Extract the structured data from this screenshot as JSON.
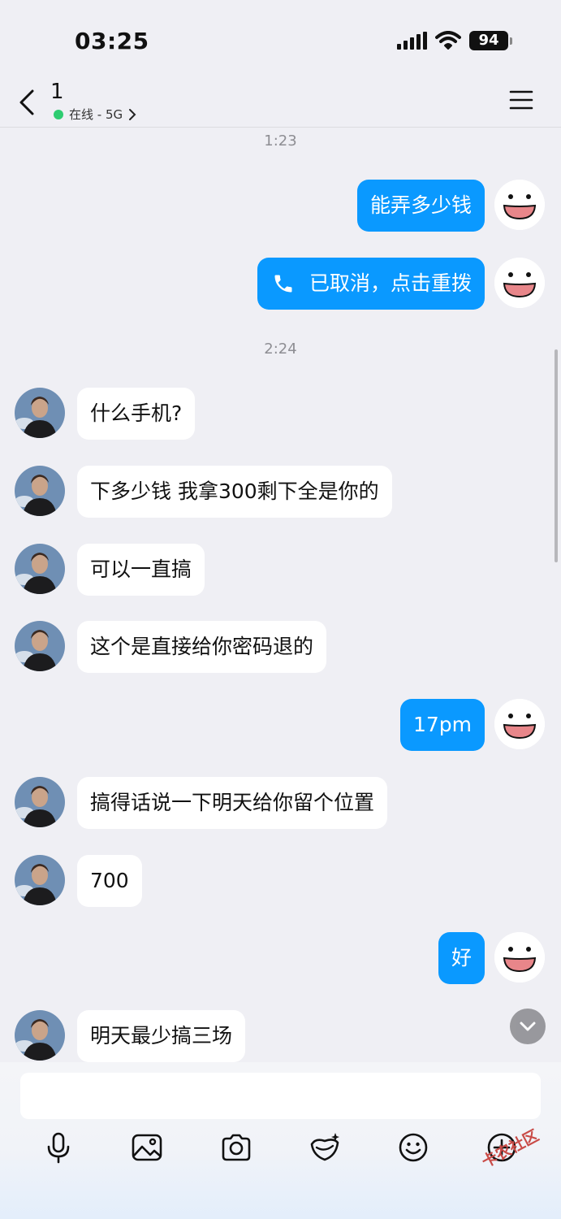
{
  "status_bar": {
    "time": "03:25",
    "battery": "94"
  },
  "header": {
    "title": "1",
    "status": "在线 - 5G"
  },
  "colors": {
    "bubble_out": "#0a99ff",
    "bubble_in": "#ffffff",
    "online_dot": "#2ecc71"
  },
  "messages": [
    {
      "type": "time",
      "text": "1:23"
    },
    {
      "dir": "out",
      "text": "能弄多少钱"
    },
    {
      "dir": "out",
      "kind": "call",
      "text": "已取消，点击重拨"
    },
    {
      "type": "time",
      "text": "2:24"
    },
    {
      "dir": "in",
      "text": "什么手机?"
    },
    {
      "dir": "in",
      "text": "下多少钱 我拿300剩下全是你的"
    },
    {
      "dir": "in",
      "text": "可以一直搞"
    },
    {
      "dir": "in",
      "text": "这个是直接给你密码退的"
    },
    {
      "dir": "out",
      "text": "17pm"
    },
    {
      "dir": "in",
      "text": "搞得话说一下明天给你留个位置"
    },
    {
      "dir": "in",
      "text": "700"
    },
    {
      "dir": "out",
      "text": "好"
    },
    {
      "dir": "in",
      "text": "明天最少搞三场"
    }
  ],
  "composer": {
    "value": "",
    "placeholder": ""
  },
  "toolbar": [
    "microphone-icon",
    "image-icon",
    "camera-icon",
    "red-packet-icon",
    "emoji-icon",
    "plus-icon"
  ],
  "watermark": "卡农社区"
}
